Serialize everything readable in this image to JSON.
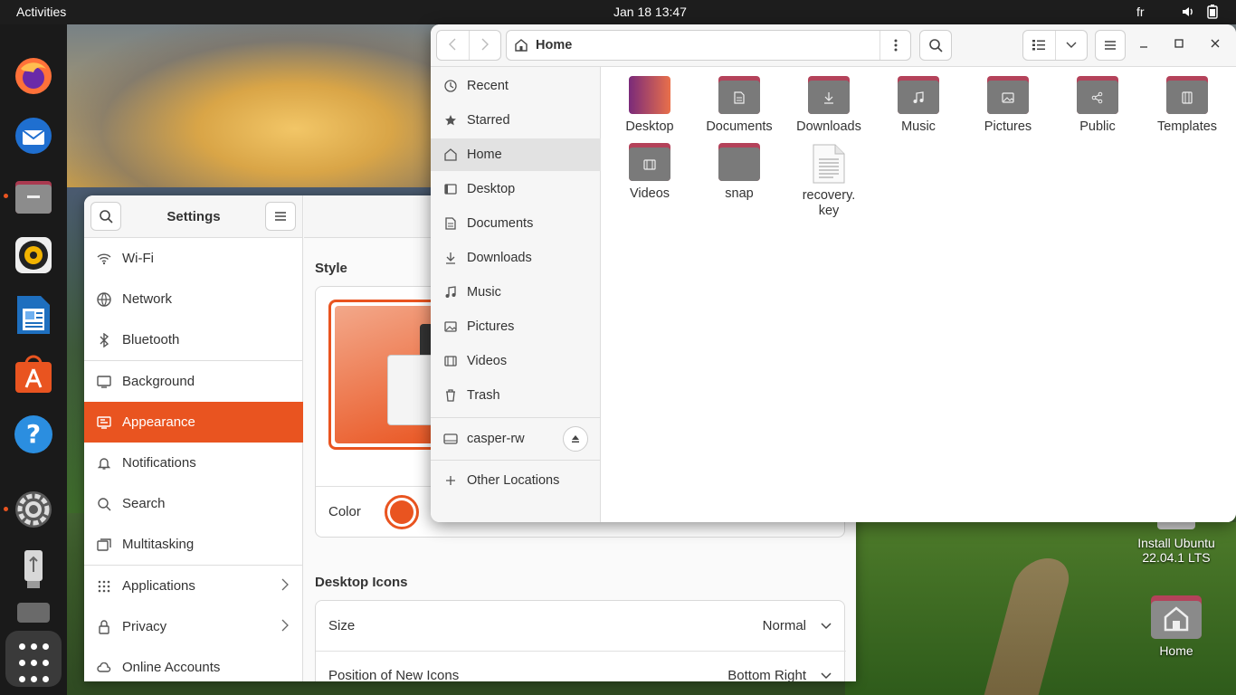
{
  "topbar": {
    "activities": "Activities",
    "clock": "Jan 18  13:47",
    "language": "fr",
    "volume_icon": "volume-icon",
    "battery_icon": "battery-icon"
  },
  "dock": {
    "items": [
      "Firefox",
      "Thunderbird",
      "Files",
      "Rhythmbox",
      "LibreOffice Writer",
      "Ubuntu Software",
      "Help",
      "Settings",
      "USB Drive",
      "Drive"
    ],
    "show_apps_icon": "grid-icon"
  },
  "desktop": {
    "install_label": "Install Ubuntu\n22.04.1 LTS",
    "install_line1": "Install Ubuntu",
    "install_line2": "22.04.1 LTS",
    "home_label": "Home"
  },
  "settings": {
    "title": "Settings",
    "nav": [
      {
        "label": "Wi-Fi",
        "icon": "wifi-icon"
      },
      {
        "label": "Network",
        "icon": "network-icon"
      },
      {
        "label": "Bluetooth",
        "icon": "bluetooth-icon"
      },
      {
        "label": "Background",
        "icon": "background-icon"
      },
      {
        "label": "Appearance",
        "icon": "appearance-icon"
      },
      {
        "label": "Notifications",
        "icon": "bell-icon"
      },
      {
        "label": "Search",
        "icon": "search-icon"
      },
      {
        "label": "Multitasking",
        "icon": "multitasking-icon"
      },
      {
        "label": "Applications",
        "icon": "apps-icon"
      },
      {
        "label": "Privacy",
        "icon": "lock-icon"
      },
      {
        "label": "Online Accounts",
        "icon": "cloud-icon"
      }
    ],
    "active": "Appearance",
    "style_title": "Style",
    "color_label": "Color",
    "accent": "#e95420",
    "desktop_icons_title": "Desktop Icons",
    "size_label": "Size",
    "size_value": "Normal",
    "position_label": "Position of New Icons",
    "position_value": "Bottom Right"
  },
  "files": {
    "location": "Home",
    "sidebar": [
      {
        "label": "Recent",
        "icon": "clock-icon"
      },
      {
        "label": "Starred",
        "icon": "star-icon"
      },
      {
        "label": "Home",
        "icon": "home-icon"
      },
      {
        "label": "Desktop",
        "icon": "desktop-icon"
      },
      {
        "label": "Documents",
        "icon": "document-icon"
      },
      {
        "label": "Downloads",
        "icon": "download-icon"
      },
      {
        "label": "Music",
        "icon": "music-icon"
      },
      {
        "label": "Pictures",
        "icon": "picture-icon"
      },
      {
        "label": "Videos",
        "icon": "video-icon"
      },
      {
        "label": "Trash",
        "icon": "trash-icon"
      }
    ],
    "drive": "casper-rw",
    "other_locations": "Other Locations",
    "items": [
      {
        "label": "Desktop",
        "icon": "desktop-folder-icon"
      },
      {
        "label": "Documents",
        "icon": "documents-folder-icon"
      },
      {
        "label": "Downloads",
        "icon": "downloads-folder-icon"
      },
      {
        "label": "Music",
        "icon": "music-folder-icon"
      },
      {
        "label": "Pictures",
        "icon": "pictures-folder-icon"
      },
      {
        "label": "Public",
        "icon": "public-folder-icon"
      },
      {
        "label": "Templates",
        "icon": "templates-folder-icon"
      },
      {
        "label": "Videos",
        "icon": "videos-folder-icon"
      },
      {
        "label": "snap",
        "icon": "folder-icon"
      },
      {
        "label": "recovery.\nkey",
        "label_line1": "recovery.",
        "label_line2": "key",
        "icon": "text-file-icon"
      }
    ]
  }
}
